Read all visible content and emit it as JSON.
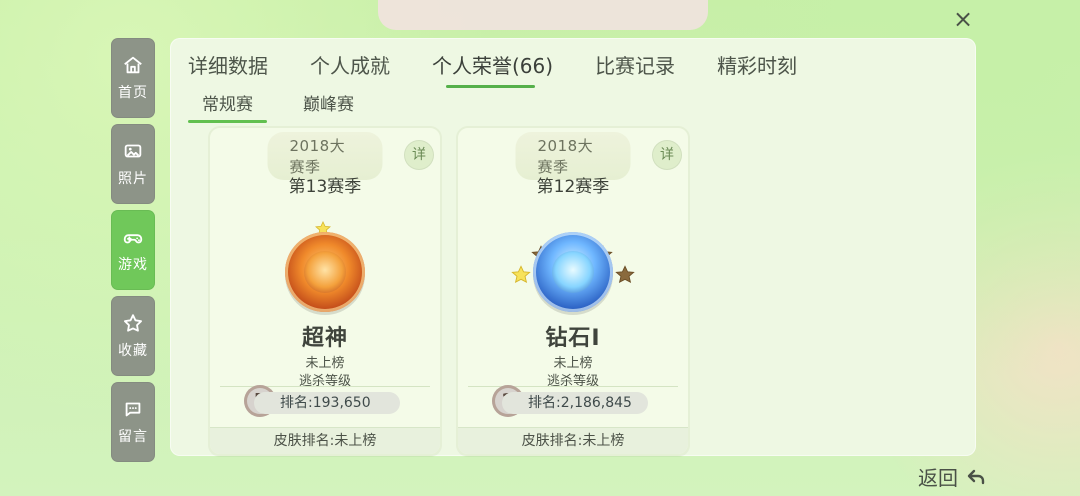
{
  "window": {
    "close_label": "×"
  },
  "nav": {
    "items": [
      {
        "label": "首页",
        "icon": "home-icon",
        "active": false
      },
      {
        "label": "照片",
        "icon": "photo-icon",
        "active": false
      },
      {
        "label": "游戏",
        "icon": "gamepad-icon",
        "active": true
      },
      {
        "label": "收藏",
        "icon": "star-outline-icon",
        "active": false
      },
      {
        "label": "留言",
        "icon": "message-icon",
        "active": false
      }
    ]
  },
  "tabs": [
    {
      "label": "详细数据",
      "active": false
    },
    {
      "label": "个人成就",
      "active": false
    },
    {
      "label": "个人荣誉(66)",
      "active": true
    },
    {
      "label": "比赛记录",
      "active": false
    },
    {
      "label": "精彩时刻",
      "active": false
    }
  ],
  "subtabs": [
    {
      "label": "常规赛",
      "active": true
    },
    {
      "label": "巅峰赛",
      "active": false
    }
  ],
  "cards": [
    {
      "season_banner": "2018大赛季",
      "detail_label": "详",
      "season": "第13赛季",
      "rank_title": "超神",
      "line1": "未上榜",
      "line2": "逃杀等级",
      "medal_level": "5",
      "rank_value": "排名:193,650",
      "footer": "皮肤排名:未上榜",
      "badge_theme": "gold"
    },
    {
      "season_banner": "2018大赛季",
      "detail_label": "详",
      "season": "第12赛季",
      "rank_title": "钻石I",
      "line1": "未上榜",
      "line2": "逃杀等级",
      "medal_level": "2",
      "rank_value": "排名:2,186,845",
      "footer": "皮肤排名:未上榜",
      "badge_theme": "blue"
    }
  ],
  "bottom": {
    "back_label": "返回"
  },
  "colors": {
    "accent_green": "#70c85a",
    "nav_inactive": "#8d9488"
  }
}
